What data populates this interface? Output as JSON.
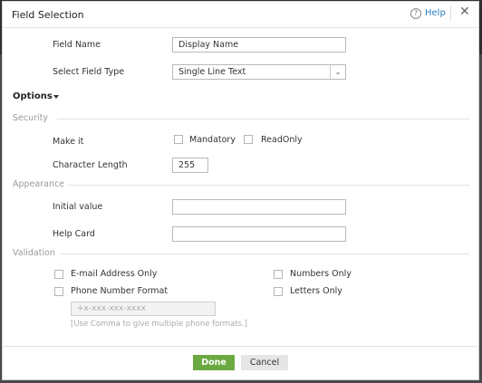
{
  "dialog": {
    "title": "Field Selection",
    "help_label": "Help",
    "close_glyph": "✕",
    "help_glyph": "?"
  },
  "fields": {
    "field_name_label": "Field Name",
    "field_name_value": "Display Name",
    "field_type_label": "Select Field Type",
    "field_type_value": "Single Line Text"
  },
  "options": {
    "label": "Options"
  },
  "security": {
    "section_label": "Security",
    "make_it_label": "Make it",
    "mandatory_label": "Mandatory",
    "readonly_label": "ReadOnly",
    "char_length_label": "Character Length",
    "char_length_value": "255"
  },
  "appearance": {
    "section_label": "Appearance",
    "initial_value_label": "Initial value",
    "initial_value": "",
    "help_card_label": "Help Card",
    "help_card_value": ""
  },
  "validation": {
    "section_label": "Validation",
    "email_label": "E-mail Address Only",
    "numbers_label": "Numbers Only",
    "phone_label": "Phone Number Format",
    "letters_label": "Letters Only",
    "phone_placeholder": "+x-xxx-xxx-xxxx",
    "phone_hint": "[Use Comma to give multiple phone formats.]"
  },
  "footer": {
    "done_label": "Done",
    "cancel_label": "Cancel"
  },
  "colors": {
    "done_button": "#6aaa40",
    "help_link": "#2a7ab8",
    "section_text": "#9a9a9a"
  }
}
